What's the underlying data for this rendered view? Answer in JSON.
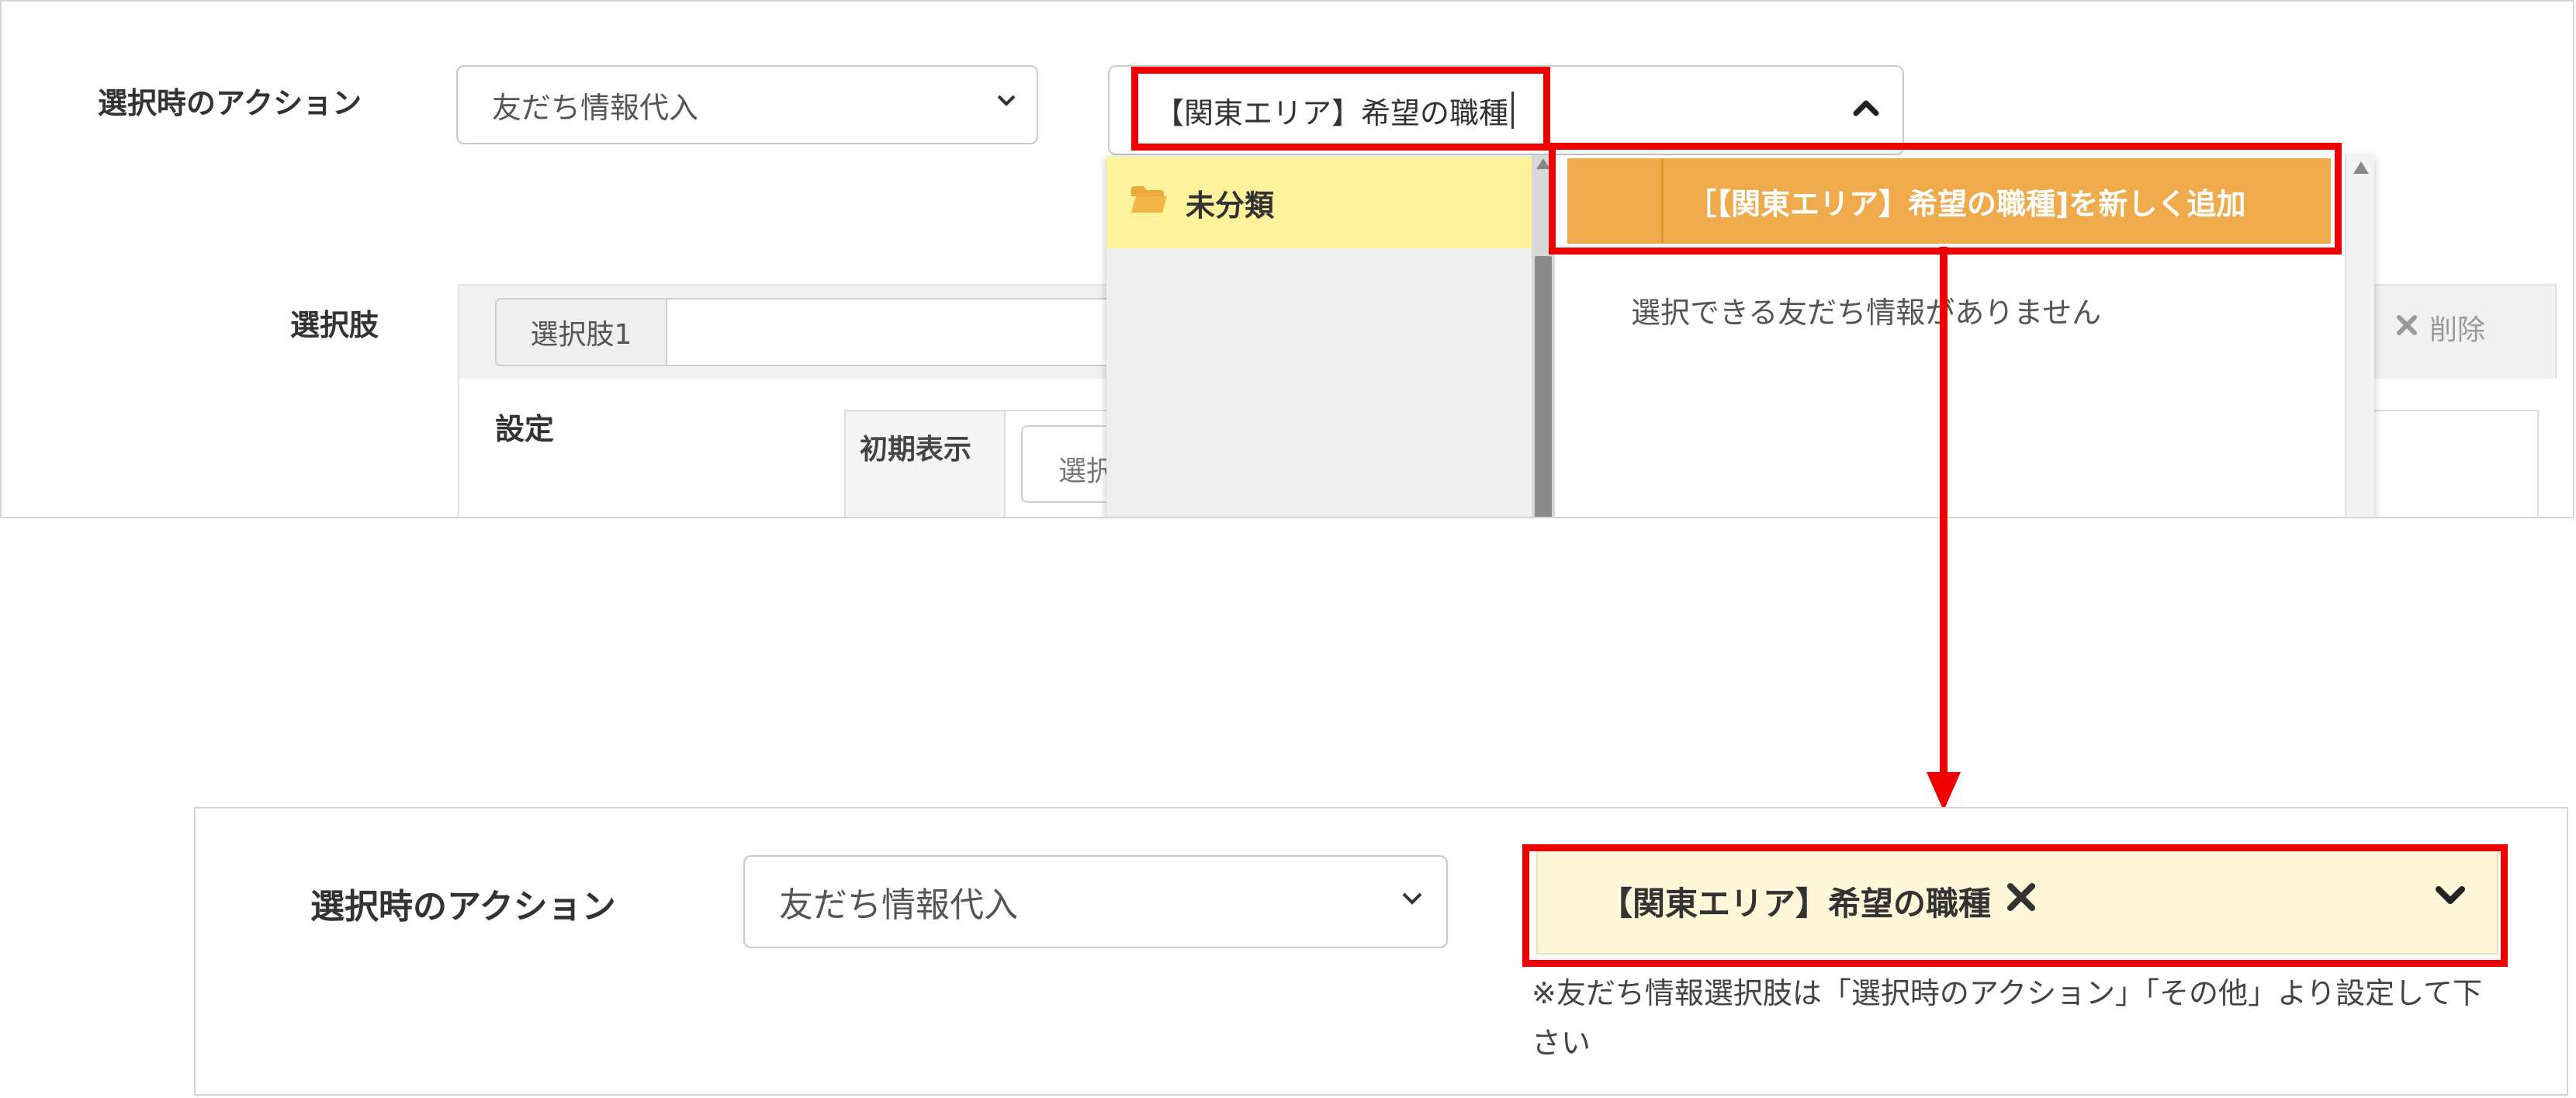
{
  "top": {
    "action_label": "選択時のアクション",
    "action_select_value": "友だち情報代入",
    "search_input_value": "【関東エリア】希望の職種",
    "choices_label": "選択肢",
    "choice_tab_label": "選択肢1",
    "delete_label": "削除",
    "settings_label": "設定",
    "initial_display_label": "初期表示",
    "initial_display_value": "選択",
    "dropdown": {
      "folder_label": "未分類",
      "add_new_label": "［【関東エリア】希望の職種]を新しく追加",
      "empty_message": "選択できる友だち情報がありません"
    }
  },
  "bottom": {
    "action_label": "選択時のアクション",
    "action_select_value": "友だち情報代入",
    "selected_value": "【関東エリア】希望の職種",
    "help_note": "※友だち情報選択肢は「選択時のアクション」「その他」より設定して下さい"
  },
  "colors": {
    "highlight_red": "#ee0000",
    "folder_yellow": "#fff29a",
    "add_new_orange": "#efab4b",
    "selected_bg": "#fff7d8"
  }
}
